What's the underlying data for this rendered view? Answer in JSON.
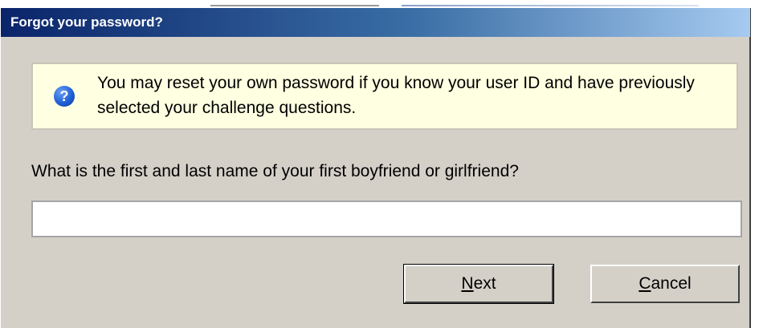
{
  "dialog": {
    "title": "Forgot your password?",
    "info_message": "You may reset your own password if you know your user ID and have previously selected your challenge questions.",
    "info_icon": "question-icon",
    "question_label": "What is the first and last name of your first boyfriend or girlfriend?",
    "answer_value": "",
    "buttons": {
      "next": {
        "mnemonic": "N",
        "rest": "ext"
      },
      "cancel": {
        "mnemonic": "C",
        "rest": "ancel"
      }
    }
  },
  "colors": {
    "title_gradient_start": "#0a246a",
    "title_gradient_end": "#a6caf0",
    "dialog_bg": "#d4d0c8",
    "info_bg": "#ffffe1",
    "icon_blue": "#1e5fd8"
  }
}
